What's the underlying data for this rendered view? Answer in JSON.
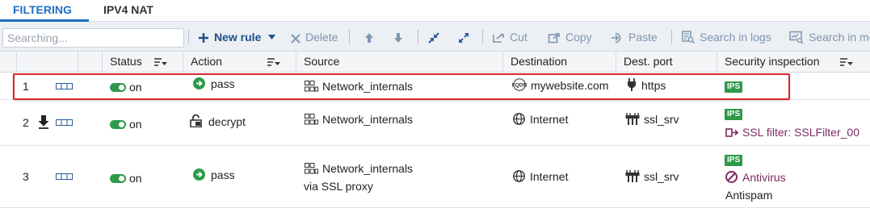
{
  "tabs": [
    {
      "label": "FILTERING",
      "active": true
    },
    {
      "label": "IPV4 NAT",
      "active": false
    }
  ],
  "toolbar": {
    "search_placeholder": "Searching...",
    "new_rule": "New rule",
    "delete": "Delete",
    "cut": "Cut",
    "copy": "Copy",
    "paste": "Paste",
    "search_in_logs": "Search in logs",
    "search_in_more": "Search in mo"
  },
  "columns": {
    "status": "Status",
    "action": "Action",
    "source": "Source",
    "destination": "Destination",
    "dest_port": "Dest. port",
    "security_inspection": "Security inspection"
  },
  "rows": [
    {
      "num": "1",
      "status": "on",
      "action": "pass",
      "source": "Network_internals",
      "source_extra": "",
      "destination": "mywebsite.com",
      "destination_icon": "fqdn-icon",
      "dest_port": "https",
      "dest_port_icon": "plug-icon",
      "inspection_badge": "IPS",
      "inspection_line1": "",
      "inspection_line2": ""
    },
    {
      "num": "2",
      "status": "on",
      "action": "decrypt",
      "source": "Network_internals",
      "source_extra": "",
      "destination": "Internet",
      "destination_icon": "globe-icon",
      "dest_port": "ssl_srv",
      "dest_port_icon": "service-group-icon",
      "inspection_badge": "IPS",
      "inspection_line1": "SSL filter: SSLFilter_00",
      "inspection_line2": ""
    },
    {
      "num": "3",
      "status": "on",
      "action": "pass",
      "source": "Network_internals",
      "source_extra": "via SSL proxy",
      "destination": "Internet",
      "destination_icon": "globe-icon",
      "dest_port": "ssl_srv",
      "dest_port_icon": "service-group-icon",
      "inspection_badge": "IPS",
      "inspection_line1": "Antivirus",
      "inspection_line2": "Antispam"
    }
  ],
  "colors": {
    "accent": "#1b6fc4",
    "toggle_on": "#2c9a49",
    "highlight": "#e1252b",
    "inspection_text": "#7d2a63"
  }
}
